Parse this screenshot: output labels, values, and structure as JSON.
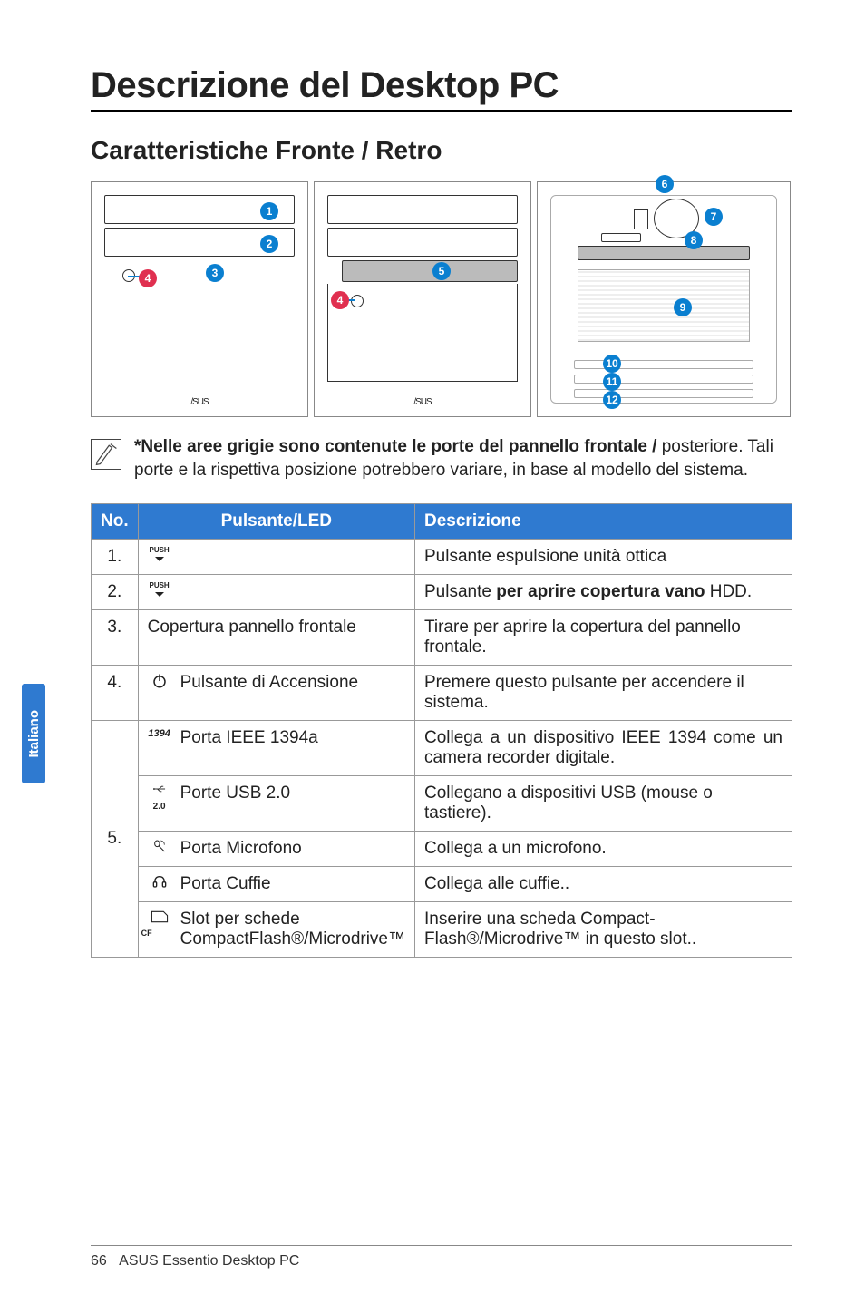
{
  "title": "Descrizione del Desktop PC",
  "subtitle": "Caratteristiche Fronte / Retro",
  "logo_text": "/SUS",
  "callouts": {
    "c1": "1",
    "c2": "2",
    "c3": "3",
    "c4": "4",
    "c5": "5",
    "c6": "6",
    "c7": "7",
    "c8": "8",
    "c9": "9",
    "c10": "10",
    "c11": "11",
    "c12": "12"
  },
  "note": {
    "bold": "*Nelle aree grigie sono contenute le porte del pannello frontale /",
    "rest": " posteriore. Tali porte e la rispettiva posizione potrebbero variare, in base al modello del sistema."
  },
  "table": {
    "headers": {
      "no": "No.",
      "pulsante": "Pulsante/LED",
      "descrizione": "Descrizione"
    },
    "icon_labels": {
      "push": "PUSH",
      "ieee": "1394",
      "usb": "2.0",
      "cf": "CF"
    },
    "rows": {
      "r1": {
        "num": "1.",
        "label": "",
        "desc": "Pulsante espulsione unità ottica"
      },
      "r2": {
        "num": "2.",
        "label": "",
        "desc_pre": "Pulsante ",
        "desc_bold": "per aprire copertura vano",
        "desc_post": " HDD."
      },
      "r3": {
        "num": "3.",
        "label": "Copertura pannello frontale",
        "desc": "Tirare per aprire la copertura del pannello frontale."
      },
      "r4": {
        "num": "4.",
        "label": "Pulsante di Accensione",
        "desc": "Premere questo pulsante per accendere il sistema."
      },
      "r5": {
        "num": "5.",
        "sub": {
          "s1": {
            "label": "Porta IEEE 1394a",
            "desc": "Collega a un dispositivo IEEE 1394 come un camera recorder digitale."
          },
          "s2": {
            "label": "Porte USB 2.0",
            "desc": "Collegano a dispositivi USB (mouse o tastiere)."
          },
          "s3": {
            "label": "Porta Microfono",
            "desc": "Collega a un microfono."
          },
          "s4": {
            "label": "Porta Cuffie",
            "desc": "Collega alle cuffie.."
          },
          "s5": {
            "label": "Slot per schede CompactFlash®/Microdrive™",
            "desc": "Inserire una scheda Compact-Flash®/Microdrive™ in questo slot.."
          }
        }
      }
    }
  },
  "sidetab": "Italiano",
  "footer": {
    "page": "66",
    "title": "ASUS Essentio Desktop PC"
  }
}
